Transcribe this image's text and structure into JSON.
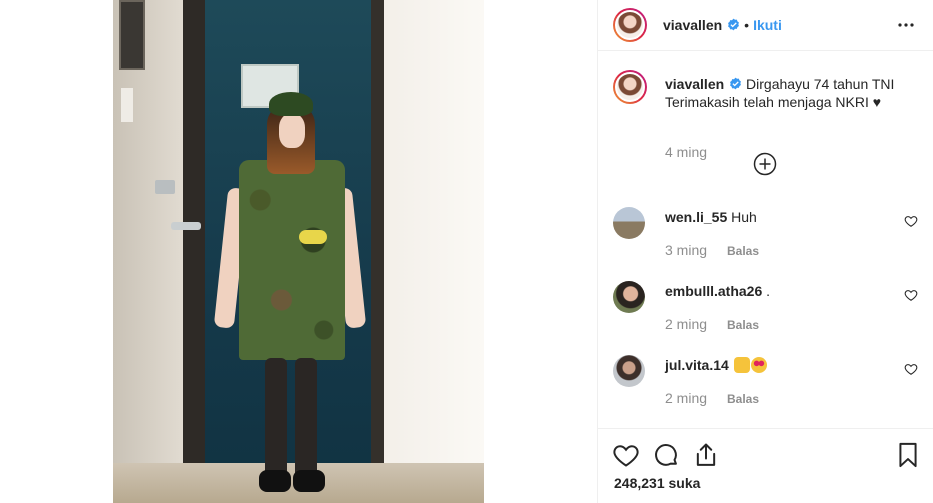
{
  "post": {
    "username": "viavallen",
    "follow_label": "Ikuti",
    "separator": "•",
    "caption_line1": "Dirgahayu 74 tahun TNI",
    "caption_line2": "Terimakasih telah menjaga NKRI ♥",
    "caption_time": "4 ming",
    "likes_count": "248,231",
    "likes_suffix": "suka"
  },
  "comments": [
    {
      "username": "wen.li_55",
      "text": "Huh",
      "time": "3 ming",
      "reply_label": "Balas"
    },
    {
      "username": "embulll.atha26",
      "text": ".",
      "time": "2 ming",
      "reply_label": "Balas"
    },
    {
      "username": "jul.vita.14",
      "text": "",
      "time": "2 ming",
      "reply_label": "Balas"
    }
  ],
  "icons": {
    "verified": "verified-badge-icon",
    "more": "more-options-icon",
    "load_more": "load-more-comments-icon",
    "like": "heart-icon",
    "comment": "comment-icon",
    "share": "share-icon",
    "save": "bookmark-icon"
  },
  "colors": {
    "accent": "#3897f0",
    "text": "#262626",
    "muted": "#8e8e8e",
    "divider": "#efefef"
  }
}
